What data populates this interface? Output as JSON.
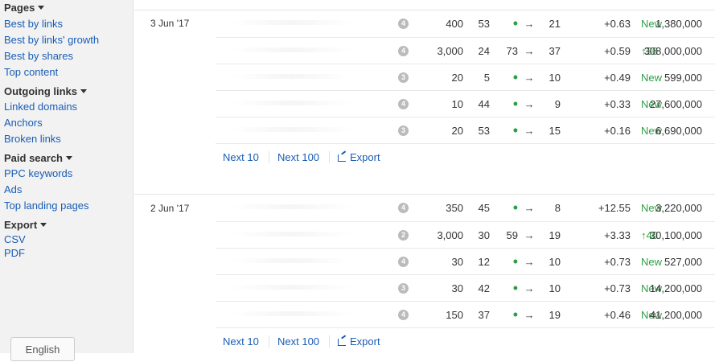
{
  "sidebar": {
    "sections": [
      {
        "heading": "Pages",
        "items": [
          "Best by links",
          "Best by links' growth",
          "Best by shares",
          "Top content"
        ]
      },
      {
        "heading": "Outgoing links",
        "items": [
          "Linked domains",
          "Anchors",
          "Broken links"
        ]
      },
      {
        "heading": "Paid search",
        "items": [
          "PPC keywords",
          "Ads",
          "Top landing pages"
        ]
      },
      {
        "heading": "Export",
        "items": [
          "CSV",
          "PDF"
        ]
      }
    ],
    "language_button": "English"
  },
  "groups": [
    {
      "date": "3 Jun '17",
      "rows": [
        {
          "badge": "4",
          "volume": "400",
          "kd": "53",
          "prev": "•",
          "arrow": "→",
          "pos": "21",
          "change": "New",
          "delta": "+0.63",
          "traffic": "1,380,000"
        },
        {
          "badge": "4",
          "volume": "3,000",
          "kd": "24",
          "prev": "73",
          "arrow": "→",
          "pos": "37",
          "change": "↑36",
          "delta": "+0.59",
          "traffic": "308,000,000"
        },
        {
          "badge": "3",
          "volume": "20",
          "kd": "5",
          "prev": "•",
          "arrow": "→",
          "pos": "10",
          "change": "New",
          "delta": "+0.49",
          "traffic": "599,000"
        },
        {
          "badge": "4",
          "volume": "10",
          "kd": "44",
          "prev": "•",
          "arrow": "→",
          "pos": "9",
          "change": "New",
          "delta": "+0.33",
          "traffic": "27,600,000"
        },
        {
          "badge": "3",
          "volume": "20",
          "kd": "53",
          "prev": "•",
          "arrow": "→",
          "pos": "15",
          "change": "New",
          "delta": "+0.16",
          "traffic": "6,690,000"
        }
      ],
      "pager": {
        "next10": "Next 10",
        "next100": "Next 100",
        "export": "Export"
      }
    },
    {
      "date": "2 Jun '17",
      "rows": [
        {
          "badge": "4",
          "volume": "350",
          "kd": "45",
          "prev": "•",
          "arrow": "→",
          "pos": "8",
          "change": "New",
          "delta": "+12.55",
          "traffic": "3,220,000"
        },
        {
          "badge": "2",
          "volume": "3,000",
          "kd": "30",
          "prev": "59",
          "arrow": "→",
          "pos": "19",
          "change": "↑40",
          "delta": "+3.33",
          "traffic": "30,100,000"
        },
        {
          "badge": "4",
          "volume": "30",
          "kd": "12",
          "prev": "•",
          "arrow": "→",
          "pos": "10",
          "change": "New",
          "delta": "+0.73",
          "traffic": "527,000"
        },
        {
          "badge": "3",
          "volume": "30",
          "kd": "42",
          "prev": "•",
          "arrow": "→",
          "pos": "10",
          "change": "New",
          "delta": "+0.73",
          "traffic": "14,200,000"
        },
        {
          "badge": "4",
          "volume": "150",
          "kd": "37",
          "prev": "•",
          "arrow": "→",
          "pos": "19",
          "change": "New",
          "delta": "+0.46",
          "traffic": "41,200,000"
        }
      ],
      "pager": {
        "next10": "Next 10",
        "next100": "Next 100",
        "export": "Export"
      }
    }
  ],
  "colors": {
    "link": "#1a5db5",
    "positive": "#2e9e46",
    "badge": "#bbbbbb"
  }
}
